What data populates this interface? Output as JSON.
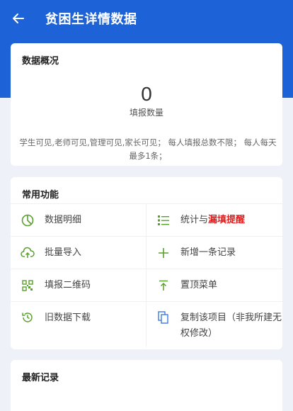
{
  "header": {
    "title": "贫困生详情数据"
  },
  "overview": {
    "title": "数据概况",
    "count": "0",
    "count_label": "填报数量",
    "note": "学生可见,老师可见,管理可见,家长可见；  每人填报总数不限；  每人每天最多1条；"
  },
  "functions": {
    "title": "常用功能",
    "items": [
      {
        "label": "数据明细",
        "icon": "pie-chart-icon"
      },
      {
        "label": "统计与",
        "label_alert": "漏填提醒",
        "icon": "list-icon"
      },
      {
        "label": "批量导入",
        "icon": "cloud-upload-icon"
      },
      {
        "label": "新增一条记录",
        "icon": "plus-icon"
      },
      {
        "label": "填报二维码",
        "icon": "qr-code-icon"
      },
      {
        "label": "置顶菜单",
        "icon": "pin-top-icon"
      },
      {
        "label": "旧数据下载",
        "icon": "history-icon"
      },
      {
        "label": "复制该项目（非我所建无权修改）",
        "icon": "copy-icon"
      }
    ]
  },
  "recent": {
    "title": "最新记录"
  },
  "colors": {
    "header": "#1d62d6",
    "icon_green": "#5aa02c",
    "copy_blue": "#3d7be0",
    "alert_red": "#e02020"
  }
}
